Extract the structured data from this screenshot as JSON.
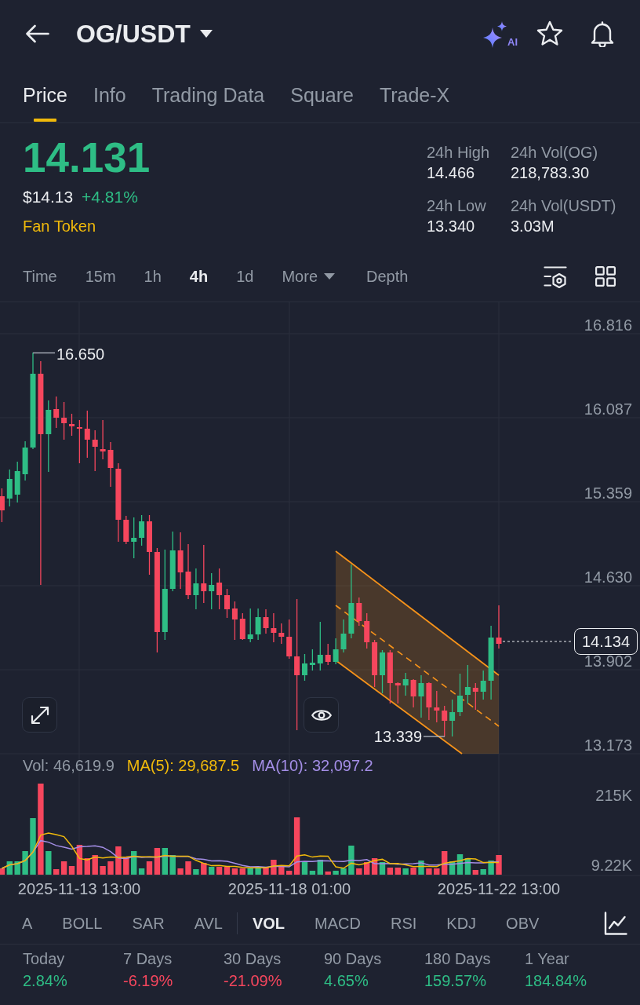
{
  "header": {
    "title": "OG/USDT",
    "ai_label": "AI"
  },
  "tabs": [
    {
      "label": "Price",
      "selected": true
    },
    {
      "label": "Info",
      "selected": false
    },
    {
      "label": "Trading Data",
      "selected": false
    },
    {
      "label": "Square",
      "selected": false
    },
    {
      "label": "Trade-X",
      "selected": false
    }
  ],
  "ticker": {
    "last_price": "14.131",
    "fiat_price": "$14.13",
    "change": "+4.81%",
    "rising": true,
    "tag": "Fan Token"
  },
  "stats": [
    {
      "label": "24h High",
      "value": "14.466"
    },
    {
      "label": "24h Vol(OG)",
      "value": "218,783.30"
    },
    {
      "label": "24h Low",
      "value": "13.340"
    },
    {
      "label": "24h Vol(USDT)",
      "value": "3.03M"
    }
  ],
  "intervals": [
    {
      "label": "Time",
      "kind": "option",
      "selected": false
    },
    {
      "label": "15m",
      "kind": "option",
      "selected": false
    },
    {
      "label": "1h",
      "kind": "option",
      "selected": false
    },
    {
      "label": "4h",
      "kind": "option",
      "selected": true
    },
    {
      "label": "1d",
      "kind": "option",
      "selected": false
    },
    {
      "label": "More",
      "kind": "dropdown",
      "selected": false
    },
    {
      "label": "Depth",
      "kind": "view",
      "selected": false
    }
  ],
  "chart": {
    "price_axis": [
      "16.816",
      "16.087",
      "15.359",
      "14.630",
      "13.902",
      "13.173"
    ],
    "high_label": "16.650",
    "low_label": "13.339",
    "last_price_tag": "14.134",
    "volume_legend": [
      {
        "text": "Vol: 46,619.9",
        "color": "#929aa5"
      },
      {
        "text": "MA(5): 29,687.5",
        "color": "#f0b90b"
      },
      {
        "text": "MA(10): 32,097.2",
        "color": "#a48ee6"
      }
    ],
    "volume_axis": [
      "215K",
      "9.22K"
    ],
    "time_axis": [
      "2025-11-13 13:00",
      "2025-11-18 01:00",
      "2025-11-22 13:00"
    ]
  },
  "indicators": {
    "main": [
      {
        "label": "A",
        "selected": false
      },
      {
        "label": "BOLL",
        "selected": false
      },
      {
        "label": "SAR",
        "selected": false
      },
      {
        "label": "AVL",
        "selected": false
      }
    ],
    "sub": [
      {
        "label": "VOL",
        "selected": true
      },
      {
        "label": "MACD",
        "selected": false
      },
      {
        "label": "RSI",
        "selected": false
      },
      {
        "label": "KDJ",
        "selected": false
      },
      {
        "label": "OBV",
        "selected": false
      }
    ]
  },
  "performance": [
    {
      "label": "Today",
      "value": "2.84%",
      "kind": "gain"
    },
    {
      "label": "7 Days",
      "value": "-6.19%",
      "kind": "loss"
    },
    {
      "label": "30 Days",
      "value": "-21.09%",
      "kind": "loss"
    },
    {
      "label": "90 Days",
      "value": "4.65%",
      "kind": "gain"
    },
    {
      "label": "180 Days",
      "value": "159.57%",
      "kind": "gain"
    },
    {
      "label": "1 Year",
      "value": "184.84%",
      "kind": "gain"
    }
  ]
}
